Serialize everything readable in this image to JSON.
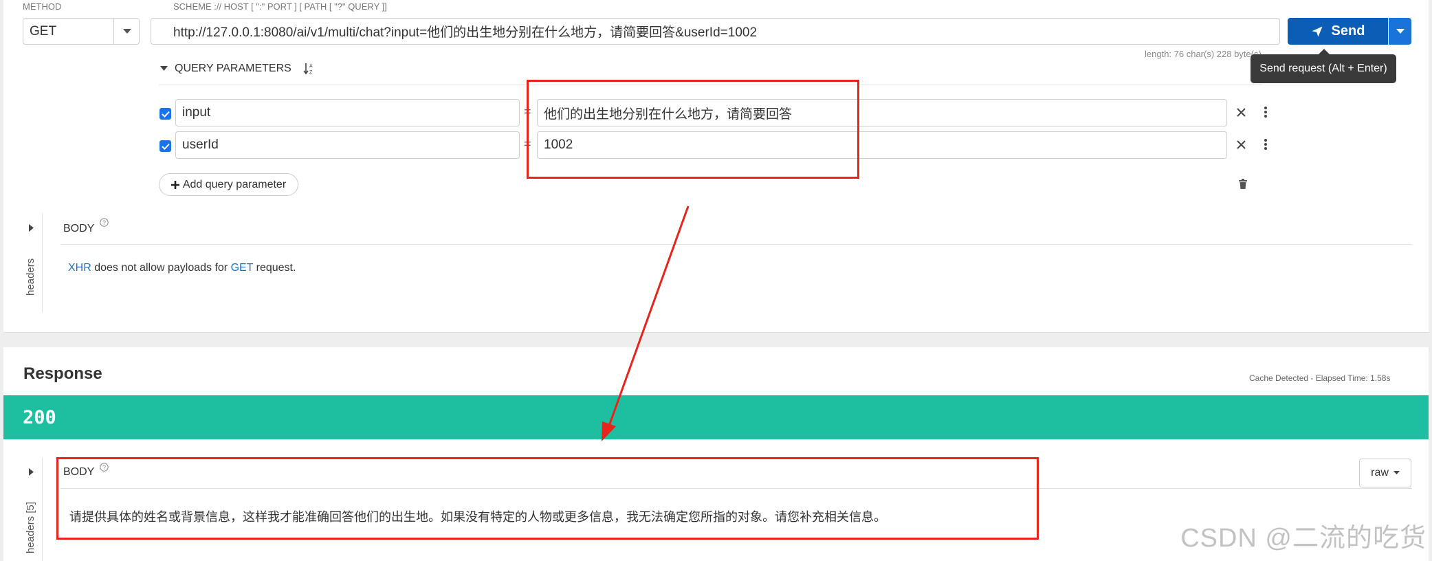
{
  "request": {
    "method_label": "METHOD",
    "method_value": "GET",
    "url_label": "SCHEME :// HOST [ \":\" PORT ] [ PATH [ \"?\" QUERY ]]",
    "url_value": "http://127.0.0.1:8080/ai/v1/multi/chat?input=他们的出生地分别在什么地方，请简要回答&userId=1002",
    "length_info": "length: 76 char(s) 228 byte(s)",
    "send_label": "Send",
    "send_tooltip": "Send request (Alt + Enter)",
    "query_params_title": "QUERY PARAMETERS",
    "params": [
      {
        "name": "input",
        "value": "他们的出生地分别在什么地方，请简要回答",
        "checked": true
      },
      {
        "name": "userId",
        "value": "1002",
        "checked": true
      }
    ],
    "add_param_label": "Add query parameter",
    "body_title": "BODY",
    "headers_tab": "headers",
    "body_message": {
      "xhr": "XHR",
      "mid": " does not allow payloads for ",
      "method": "GET",
      "end": " request."
    }
  },
  "response": {
    "title": "Response",
    "cache_info": "Cache Detected - Elapsed Time: 1.58s",
    "status_code": "200",
    "body_title": "BODY",
    "headers_tab": "headers [5]",
    "format_select": "raw",
    "body_text": "请提供具体的姓名或背景信息，这样我才能准确回答他们的出生地。如果没有特定的人物或更多信息，我无法确定您所指的对象。请您补充相关信息。"
  },
  "watermark": "CSDN @二流的吃货",
  "colors": {
    "send_button": "#0b5db5",
    "status_bar": "#1ebfa0",
    "annotation": "#e8231b",
    "link": "#1a73c9"
  },
  "icons": [
    "send-icon",
    "caret-down-icon",
    "sort-alpha-icon",
    "check-icon",
    "close-icon",
    "more-vert-icon",
    "plus-icon",
    "trash-icon",
    "help-icon",
    "expand-arrow-icon"
  ]
}
